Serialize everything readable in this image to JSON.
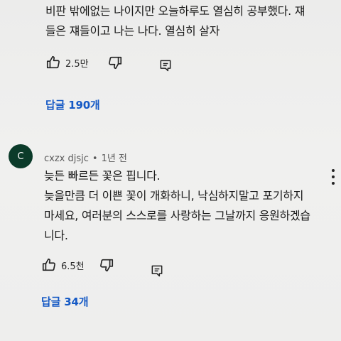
{
  "comment1": {
    "text_lines": [
      "비판 밖에없는 나이지만 오늘하루도 열심히 공부했다. 쟤",
      "들은 쟤들이고 나는 나다. 열심히 살자"
    ],
    "likes": "2.5만",
    "replies": "답글 190개"
  },
  "comment2": {
    "avatar_letter": "C",
    "author": "cxzx djsjc",
    "separator": "•",
    "time": "1년 전",
    "text_lines": [
      "늦든 빠르든 꽃은 핍니다.",
      "늦을만큼 더 이쁜 꽃이 개화하니, 낙심하지말고 포기하지",
      "마세요, 여러분의 스스로를 사랑하는 그날까지 응원하겠습",
      "니다."
    ],
    "likes": "6.5천",
    "replies": "답글 34개"
  },
  "icons": {
    "like": "thumbs-up-icon",
    "dislike": "thumbs-down-icon",
    "reply": "comment-reply-icon",
    "more": "more-vert-icon"
  },
  "colors": {
    "background": "#efefee",
    "link": "#1559c5",
    "avatar": "#0b3b2a"
  }
}
